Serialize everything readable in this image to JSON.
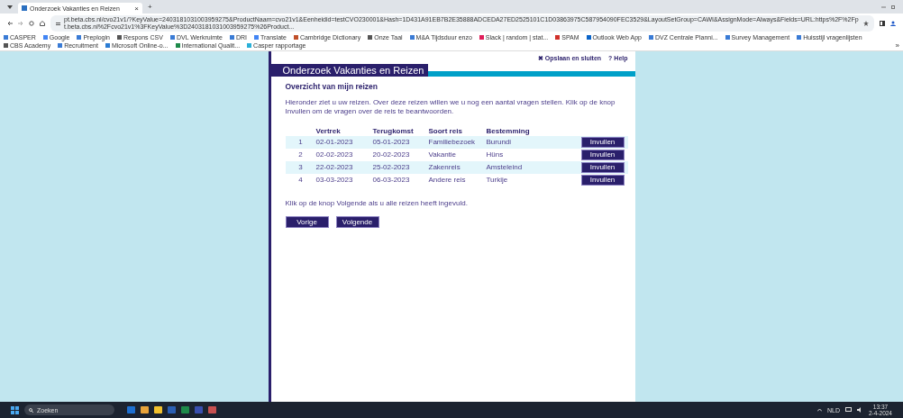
{
  "browser": {
    "tab": {
      "title": "Onderzoek Vakanties en Reizen",
      "close": "×"
    },
    "new_tab": "+",
    "address": "pt.beta.cbs.nl/cvo21v1/?KeyValue=2403181031003959275&ProductNaam=cvo21v1&Eenheidid=testCVO230001&Hash=1D431A91EB7B2E35888ADCEDA27ED2525101C1D03863975C587954090FEC3529&LayoutSetGroup=CAWI&AssignMode=Always&Fields=URL:https%2F%2Fpt.beta.cbs.nl%2Fcvo21v1%3FKeyValue%3D2403181031003959275%26Product...",
    "bookmarks": [
      {
        "label": "CASPER",
        "color": "#3a7bd5"
      },
      {
        "label": "Google",
        "color": "#4285f4"
      },
      {
        "label": "Preplogin",
        "color": "#3a7bd5"
      },
      {
        "label": "Respons CSV",
        "color": "#555555"
      },
      {
        "label": "DVL Werkruimte",
        "color": "#3a7bd5"
      },
      {
        "label": "DRI",
        "color": "#3a7bd5"
      },
      {
        "label": "Translate",
        "color": "#4285f4"
      },
      {
        "label": "Cambridge Dictionary",
        "color": "#c0502a"
      },
      {
        "label": "Onze Taal",
        "color": "#555555"
      },
      {
        "label": "M&A Tijdsduur enzo",
        "color": "#3a7bd5"
      },
      {
        "label": "Slack | random | stat...",
        "color": "#e01e5a"
      },
      {
        "label": "SPAM",
        "color": "#d0302a"
      },
      {
        "label": "Outlook Web App",
        "color": "#0a64c8"
      },
      {
        "label": "DVZ Centrale Planni...",
        "color": "#3a7bd5"
      },
      {
        "label": "Survey Management",
        "color": "#3a7bd5"
      },
      {
        "label": "Huisstijl vragenlijsten",
        "color": "#3a7bd5"
      },
      {
        "label": "CBS Academy",
        "color": "#555555"
      },
      {
        "label": "Recruitment",
        "color": "#3a7bd5"
      },
      {
        "label": "Microsoft Online-o...",
        "color": "#2b7cd3"
      },
      {
        "label": "International Qualit...",
        "color": "#1e8a4a"
      },
      {
        "label": "Casper rapportage",
        "color": "#2ab0d8"
      }
    ],
    "more": "»"
  },
  "page": {
    "links": [
      {
        "icon": "✖",
        "label": "Opslaan en sluiten"
      },
      {
        "icon": "?",
        "label": "Help"
      }
    ],
    "title": "Onderzoek Vakanties en Reizen",
    "heading": "Overzicht van mijn reizen",
    "intro": "Hieronder ziet u uw reizen. Over deze reizen willen we u nog een aantal vragen stellen. Klik op de knop Invullen om de vragen over de reis te beantwoorden.",
    "table": {
      "columns": [
        "Vertrek",
        "Terugkomst",
        "Soort reis",
        "Bestemming"
      ],
      "rows": [
        {
          "nr": "1",
          "vertrek": "02-01-2023",
          "terugkomst": "05-01-2023",
          "soort": "Familiebezoek",
          "bestemming": "Burundi",
          "button": "Invullen"
        },
        {
          "nr": "2",
          "vertrek": "02-02-2023",
          "terugkomst": "20-02-2023",
          "soort": "Vakantie",
          "bestemming": "Hüns",
          "button": "Invullen"
        },
        {
          "nr": "3",
          "vertrek": "22-02-2023",
          "terugkomst": "25-02-2023",
          "soort": "Zakenreis",
          "bestemming": "Amsteleind",
          "button": "Invullen"
        },
        {
          "nr": "4",
          "vertrek": "03-03-2023",
          "terugkomst": "06-03-2023",
          "soort": "Andere reis",
          "bestemming": "Turkije",
          "button": "Invullen"
        }
      ]
    },
    "note": "Klik op de knop Volgende als u alle reizen heeft ingevuld.",
    "buttons": [
      "Vorige",
      "Volgende"
    ]
  },
  "taskbar": {
    "search": "Zoeken",
    "language": "NLD",
    "time": "13:37",
    "date": "2-4-2024"
  }
}
